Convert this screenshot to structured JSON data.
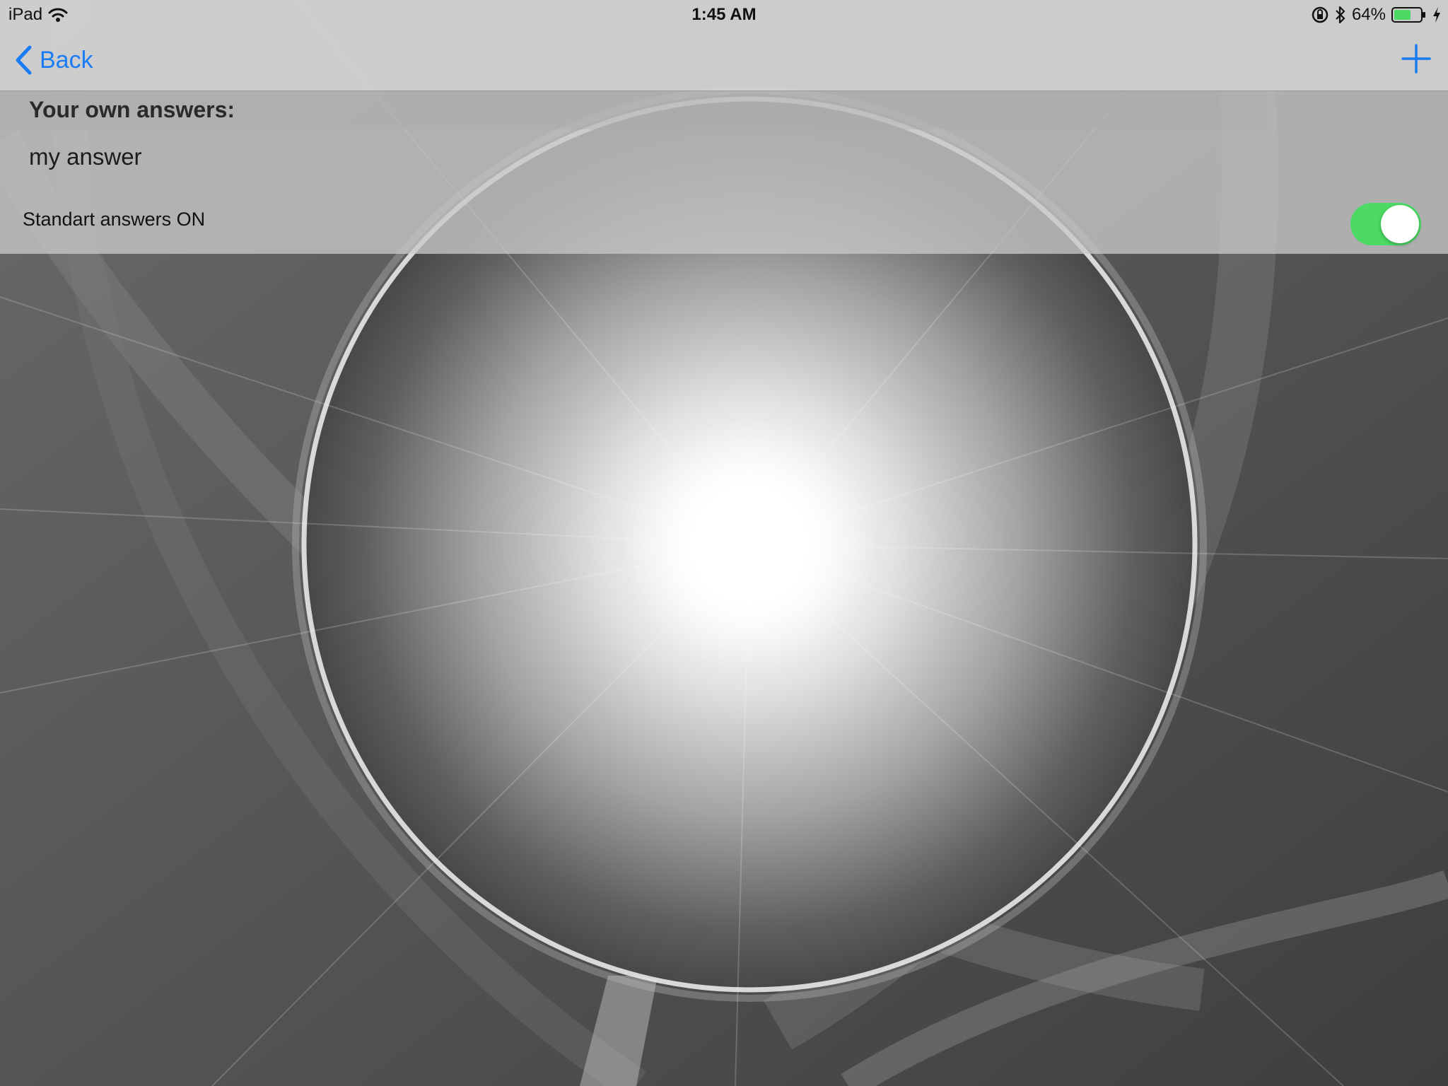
{
  "status_bar": {
    "device": "iPad",
    "time": "1:45 AM",
    "battery_percent": "64%",
    "battery_level": 0.64,
    "icons": [
      "wifi-icon",
      "rotation-lock-icon",
      "bluetooth-icon",
      "battery-icon",
      "charging-bolt-icon"
    ]
  },
  "nav": {
    "back_label": "Back",
    "back_icon": "chevron-left-icon",
    "add_icon": "plus-icon",
    "accent_color": "#1a7cf5"
  },
  "section": {
    "header": "Your own answers:",
    "answers": [
      "my answer"
    ]
  },
  "settings": {
    "standard_answers_label": "Standart answers ON",
    "standard_answers_on": true,
    "toggle_on_color": "#4cd964"
  }
}
